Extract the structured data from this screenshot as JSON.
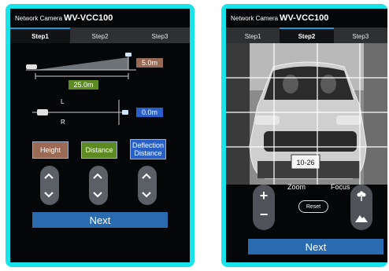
{
  "left": {
    "header": {
      "prefix": "Network Camera",
      "model": "WV-VCC100"
    },
    "tabs": [
      "Step1",
      "Step2",
      "Step3"
    ],
    "values": {
      "height": "5.0m",
      "distance": "25.0m",
      "deflection": "0.0m"
    },
    "lr": {
      "left": "L",
      "right": "R"
    },
    "buttons": {
      "height": "Height",
      "distance": "Distance",
      "deflection": "Deflection Distance"
    },
    "next": "Next"
  },
  "right": {
    "header": {
      "prefix": "Network Camera",
      "model": "WV-VCC100"
    },
    "tabs": [
      "Step1",
      "Step2",
      "Step3"
    ],
    "zoom": "Zoom",
    "focus": "Focus",
    "reset": "Reset",
    "plate": "10-26",
    "next": "Next"
  },
  "colors": {
    "frame": "#18e3ea",
    "tab_active": "#1d9bd8",
    "height_btn": "#9a6a55",
    "distance_btn": "#5e8a23",
    "deflection_btn": "#2860c8",
    "next_btn": "#2a6bb0"
  }
}
